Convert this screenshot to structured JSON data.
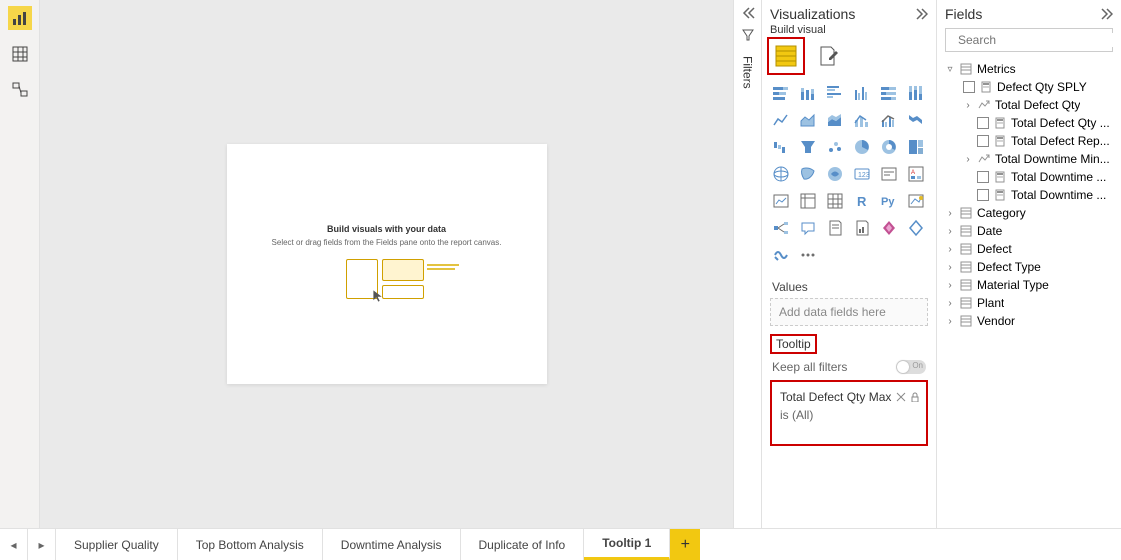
{
  "left_tools": [
    "report",
    "data",
    "model"
  ],
  "canvas": {
    "title": "Build visuals with your data",
    "hint": "Select or drag fields from the Fields pane onto the report canvas."
  },
  "filters_label": "Filters",
  "viz": {
    "header": "Visualizations",
    "sub": "Build visual",
    "values_label": "Values",
    "values_placeholder": "Add data fields here",
    "tooltip_label": "Tooltip",
    "keep_filters_label": "Keep all filters",
    "keep_filters_on": "On",
    "filter_field": "Total Defect Qty Max",
    "filter_state": "is (All)"
  },
  "fields": {
    "header": "Fields",
    "search_placeholder": "Search",
    "table": "Metrics",
    "items": [
      {
        "type": "check",
        "indent": 1,
        "icon": "calc",
        "label": "Defect Qty SPLY"
      },
      {
        "type": "expand",
        "indent": 1,
        "icon": "trend",
        "label": "Total Defect Qty"
      },
      {
        "type": "check",
        "indent": 2,
        "icon": "calc",
        "label": "Total Defect Qty ..."
      },
      {
        "type": "check",
        "indent": 2,
        "icon": "calc",
        "label": "Total Defect Rep..."
      },
      {
        "type": "expand",
        "indent": 1,
        "icon": "trend",
        "label": "Total Downtime Min..."
      },
      {
        "type": "check",
        "indent": 2,
        "icon": "calc",
        "label": "Total Downtime ..."
      },
      {
        "type": "check",
        "indent": 2,
        "icon": "calc",
        "label": "Total Downtime ..."
      }
    ],
    "tables": [
      "Category",
      "Date",
      "Defect",
      "Defect Type",
      "Material Type",
      "Plant",
      "Vendor"
    ]
  },
  "tabs": [
    "Supplier Quality",
    "Top Bottom Analysis",
    "Downtime Analysis",
    "Duplicate of Info",
    "Tooltip 1"
  ],
  "active_tab": 4
}
